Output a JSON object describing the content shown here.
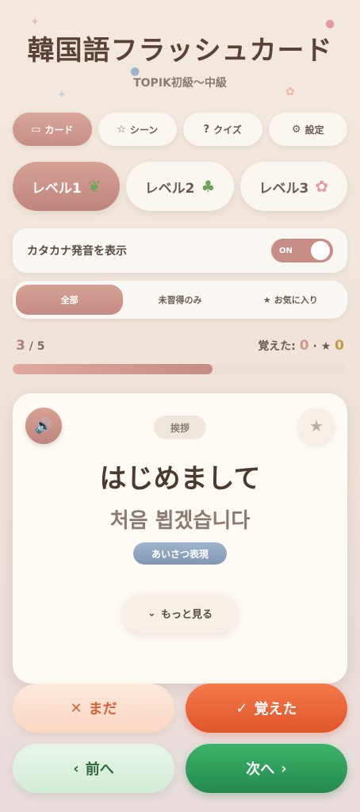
{
  "header": {
    "title": "韓国語フラッシュカード",
    "subtitle": "TOPIK初級〜中級"
  },
  "tabs": [
    {
      "label": "カード",
      "icon": "card-icon",
      "active": true
    },
    {
      "label": "シーン",
      "icon": "star-outline-icon",
      "active": false
    },
    {
      "label": "クイズ",
      "icon": "question-circle-icon",
      "active": false
    },
    {
      "label": "設定",
      "icon": "gear-icon",
      "active": false
    }
  ],
  "levels": [
    {
      "label": "レベル1",
      "icon": "sprout-icon",
      "active": true
    },
    {
      "label": "レベル2",
      "icon": "seedling-icon",
      "active": false
    },
    {
      "label": "レベル3",
      "icon": "flowers-icon",
      "active": false
    }
  ],
  "katakana_toggle": {
    "label": "カタカナ発音を表示",
    "state": "ON"
  },
  "filters": [
    {
      "label": "全部",
      "active": true
    },
    {
      "label": "未習得のみ",
      "active": false
    },
    {
      "label": "お気に入り",
      "active": false
    }
  ],
  "progress": {
    "current": "3",
    "total": "/ 5",
    "fraction": 0.6,
    "learned_label": "覚えた:",
    "learned_count": "0",
    "separator": "·",
    "favorite_count": "0"
  },
  "card": {
    "category": "挨拶",
    "japanese": "はじめまして",
    "korean": "처음 뵙겠습니다",
    "tag": "あいさつ表現",
    "more_label": "もっと見る"
  },
  "actions": {
    "mada_label": "まだ",
    "oboeta_label": "覚えた",
    "prev_label": "前へ",
    "next_label": "次へ"
  },
  "colors": {
    "accent": "#c78d84",
    "orange": "#e0552a",
    "green": "#258a4d",
    "tag_blue": "#7f98b5"
  }
}
